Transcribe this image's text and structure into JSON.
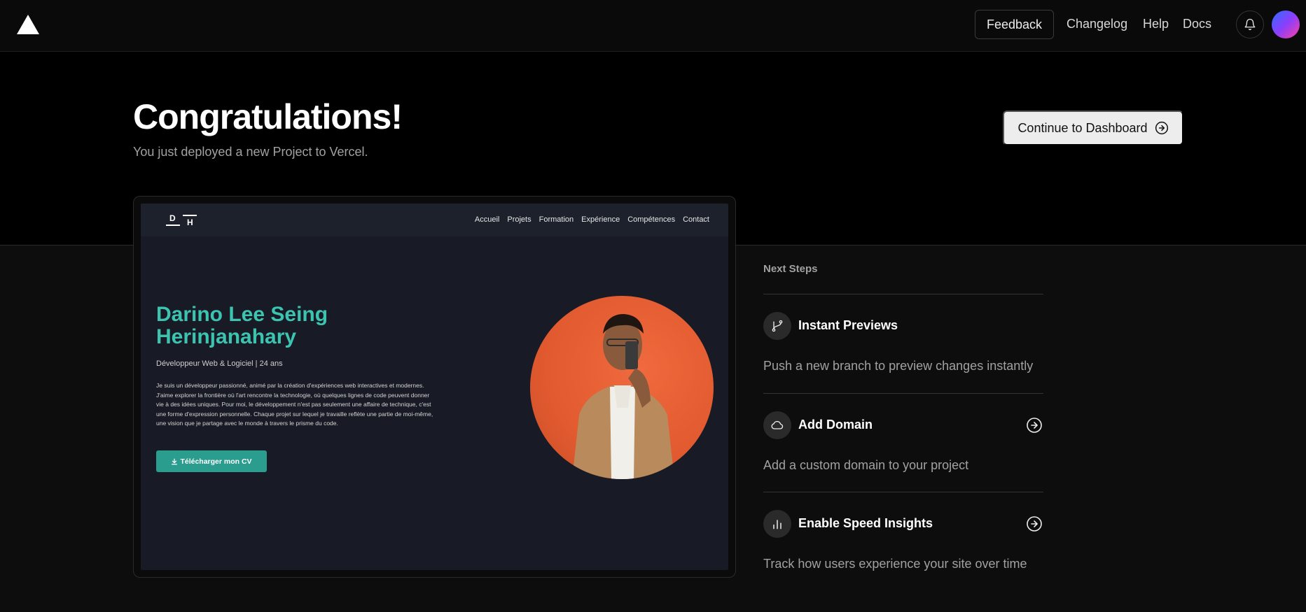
{
  "header": {
    "feedback": "Feedback",
    "links": [
      "Changelog",
      "Help",
      "Docs"
    ]
  },
  "hero": {
    "title": "Congratulations!",
    "subtitle": "You just deployed a new Project to Vercel.",
    "cta": "Continue to Dashboard"
  },
  "preview": {
    "logo_letters": [
      "D",
      "H"
    ],
    "nav": [
      "Accueil",
      "Projets",
      "Formation",
      "Expérience",
      "Compétences",
      "Contact"
    ],
    "name": "Darino Lee Seing Herinjanahary",
    "role": "Développeur Web & Logiciel | 24 ans",
    "bio": "Je suis un développeur passionné, animé par la création d'expériences web interactives et modernes. J'aime explorer la frontière où l'art rencontre la technologie, où quelques lignes de code peuvent donner vie à des idées uniques. Pour moi, le développement n'est pas seulement une affaire de technique, c'est une forme d'expression personnelle. Chaque projet sur lequel je travaille reflète une partie de moi-même, une vision que je partage avec le monde à travers le prisme du code.",
    "cv_button": "Télécharger mon CV"
  },
  "next_steps": {
    "label": "Next Steps",
    "items": [
      {
        "title": "Instant Previews",
        "desc": "Push a new branch to preview changes instantly",
        "icon": "git-branch-icon"
      },
      {
        "title": "Add Domain",
        "desc": "Add a custom domain to your project",
        "icon": "cloud-icon"
      },
      {
        "title": "Enable Speed Insights",
        "desc": "Track how users experience your site over time",
        "icon": "bar-chart-icon"
      }
    ]
  },
  "colors": {
    "accent_teal": "#3cc4b0",
    "cv_button": "#2a9d8f",
    "portrait_bg": "#e25a2f"
  }
}
